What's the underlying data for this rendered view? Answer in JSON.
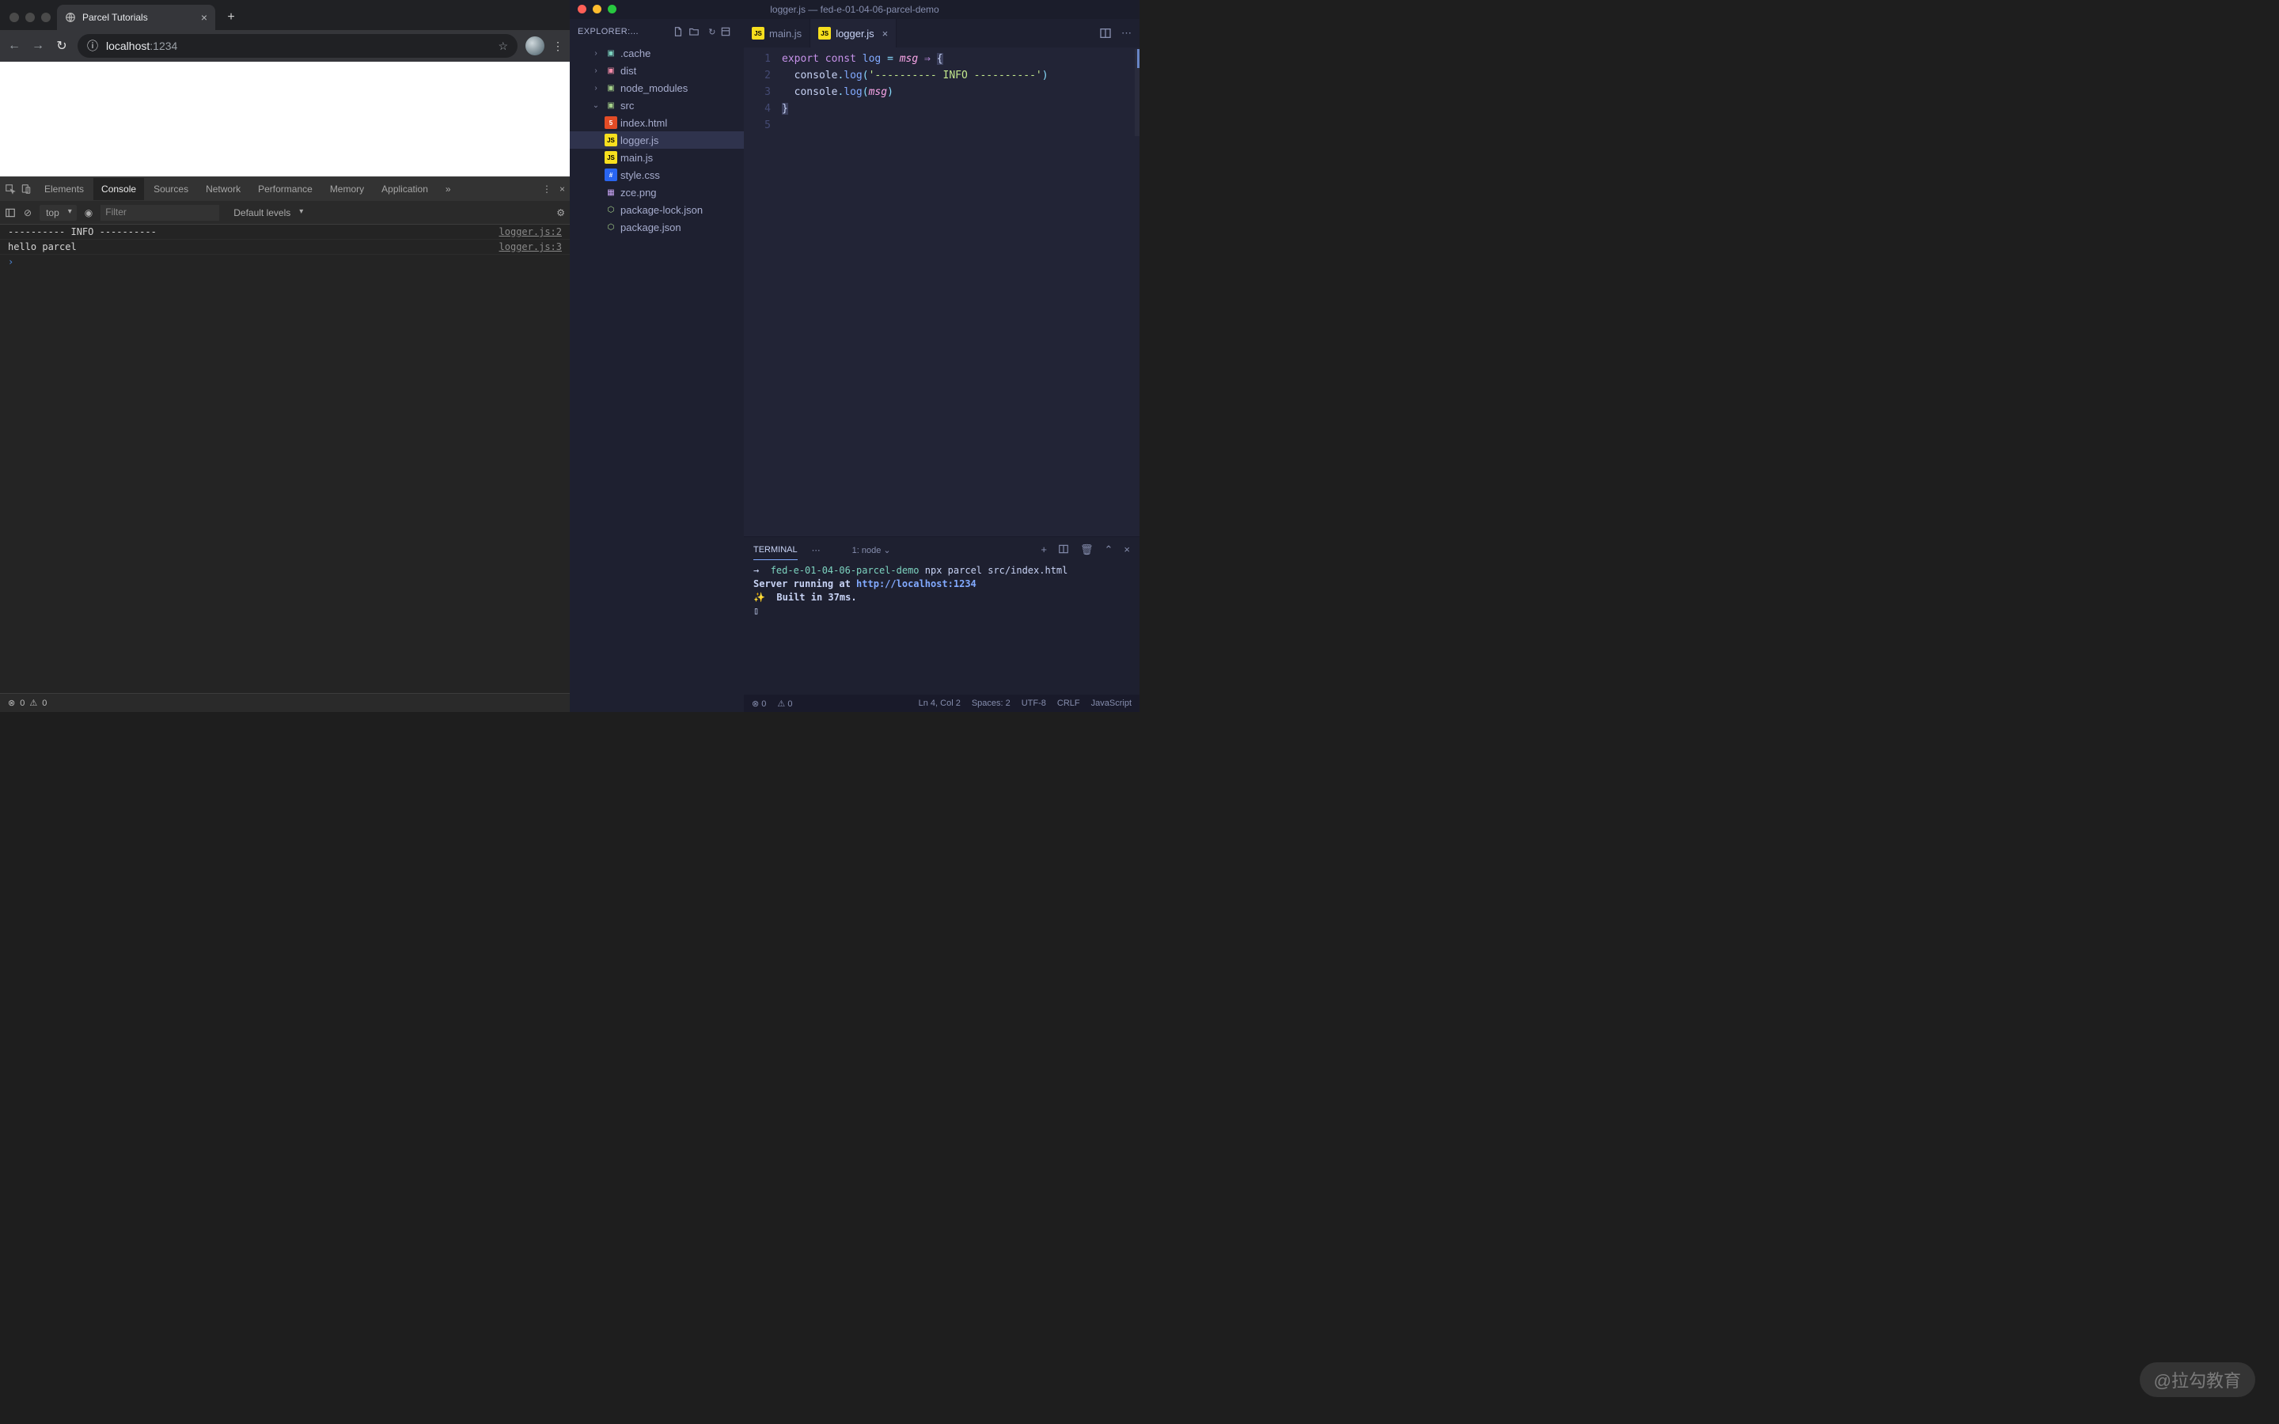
{
  "browser": {
    "tab_title": "Parcel Tutorials",
    "url_host": "localhost",
    "url_port": ":1234"
  },
  "devtools": {
    "tabs": [
      "Elements",
      "Console",
      "Sources",
      "Network",
      "Performance",
      "Memory",
      "Application"
    ],
    "active_tab_index": 1,
    "context": "top",
    "filter_placeholder": "Filter",
    "levels": "Default levels",
    "rows": [
      {
        "text": "---------- INFO ----------",
        "src": "logger.js:2"
      },
      {
        "text": "hello parcel",
        "src": "logger.js:3"
      }
    ],
    "footer_errors": "0",
    "footer_warnings": "0"
  },
  "vscode": {
    "title": "logger.js — fed-e-01-04-06-parcel-demo",
    "explorer_label": "EXPLORER:...",
    "tree": {
      "cache": ".cache",
      "dist": "dist",
      "nm": "node_modules",
      "src": "src",
      "files": {
        "index": "index.html",
        "logger": "logger.js",
        "main": "main.js",
        "style": "style.css",
        "zce": "zce.png"
      },
      "pkglock": "package-lock.json",
      "pkg": "package.json"
    },
    "tabs": [
      {
        "icon": "js",
        "name": "main.js",
        "active": false
      },
      {
        "icon": "js",
        "name": "logger.js",
        "active": true
      }
    ],
    "code": {
      "line1": {
        "a": "export",
        "b": "const",
        "c": "log",
        "d": "=",
        "e": "msg",
        "f": "⇒",
        "g": "{"
      },
      "line2": {
        "a": "console",
        "b": ".",
        "c": "log",
        "d": "(",
        "e": "'---------- INFO ----------'",
        "f": ")"
      },
      "line3": {
        "a": "console",
        "b": ".",
        "c": "log",
        "d": "(",
        "e": "msg",
        "f": ")"
      },
      "line4": "}",
      "line_numbers": [
        "1",
        "2",
        "3",
        "4",
        "5"
      ]
    },
    "terminal": {
      "tab": "TERMINAL",
      "dropdown": "1: node",
      "prompt_arrow": "→",
      "cwd": "fed-e-01-04-06-parcel-demo",
      "cmd": "npx parcel src/index.html",
      "serving": "Server running at ",
      "url": "http://localhost:1234",
      "built": "Built in 37ms.",
      "cursor": "▯"
    },
    "status": {
      "errors": "0",
      "warnings": "0",
      "pos": "Ln 4, Col 2",
      "spaces": "Spaces: 2",
      "enc": "UTF-8",
      "eol": "CRLF",
      "lang": "JavaScript"
    }
  },
  "watermark": "@拉勾教育"
}
